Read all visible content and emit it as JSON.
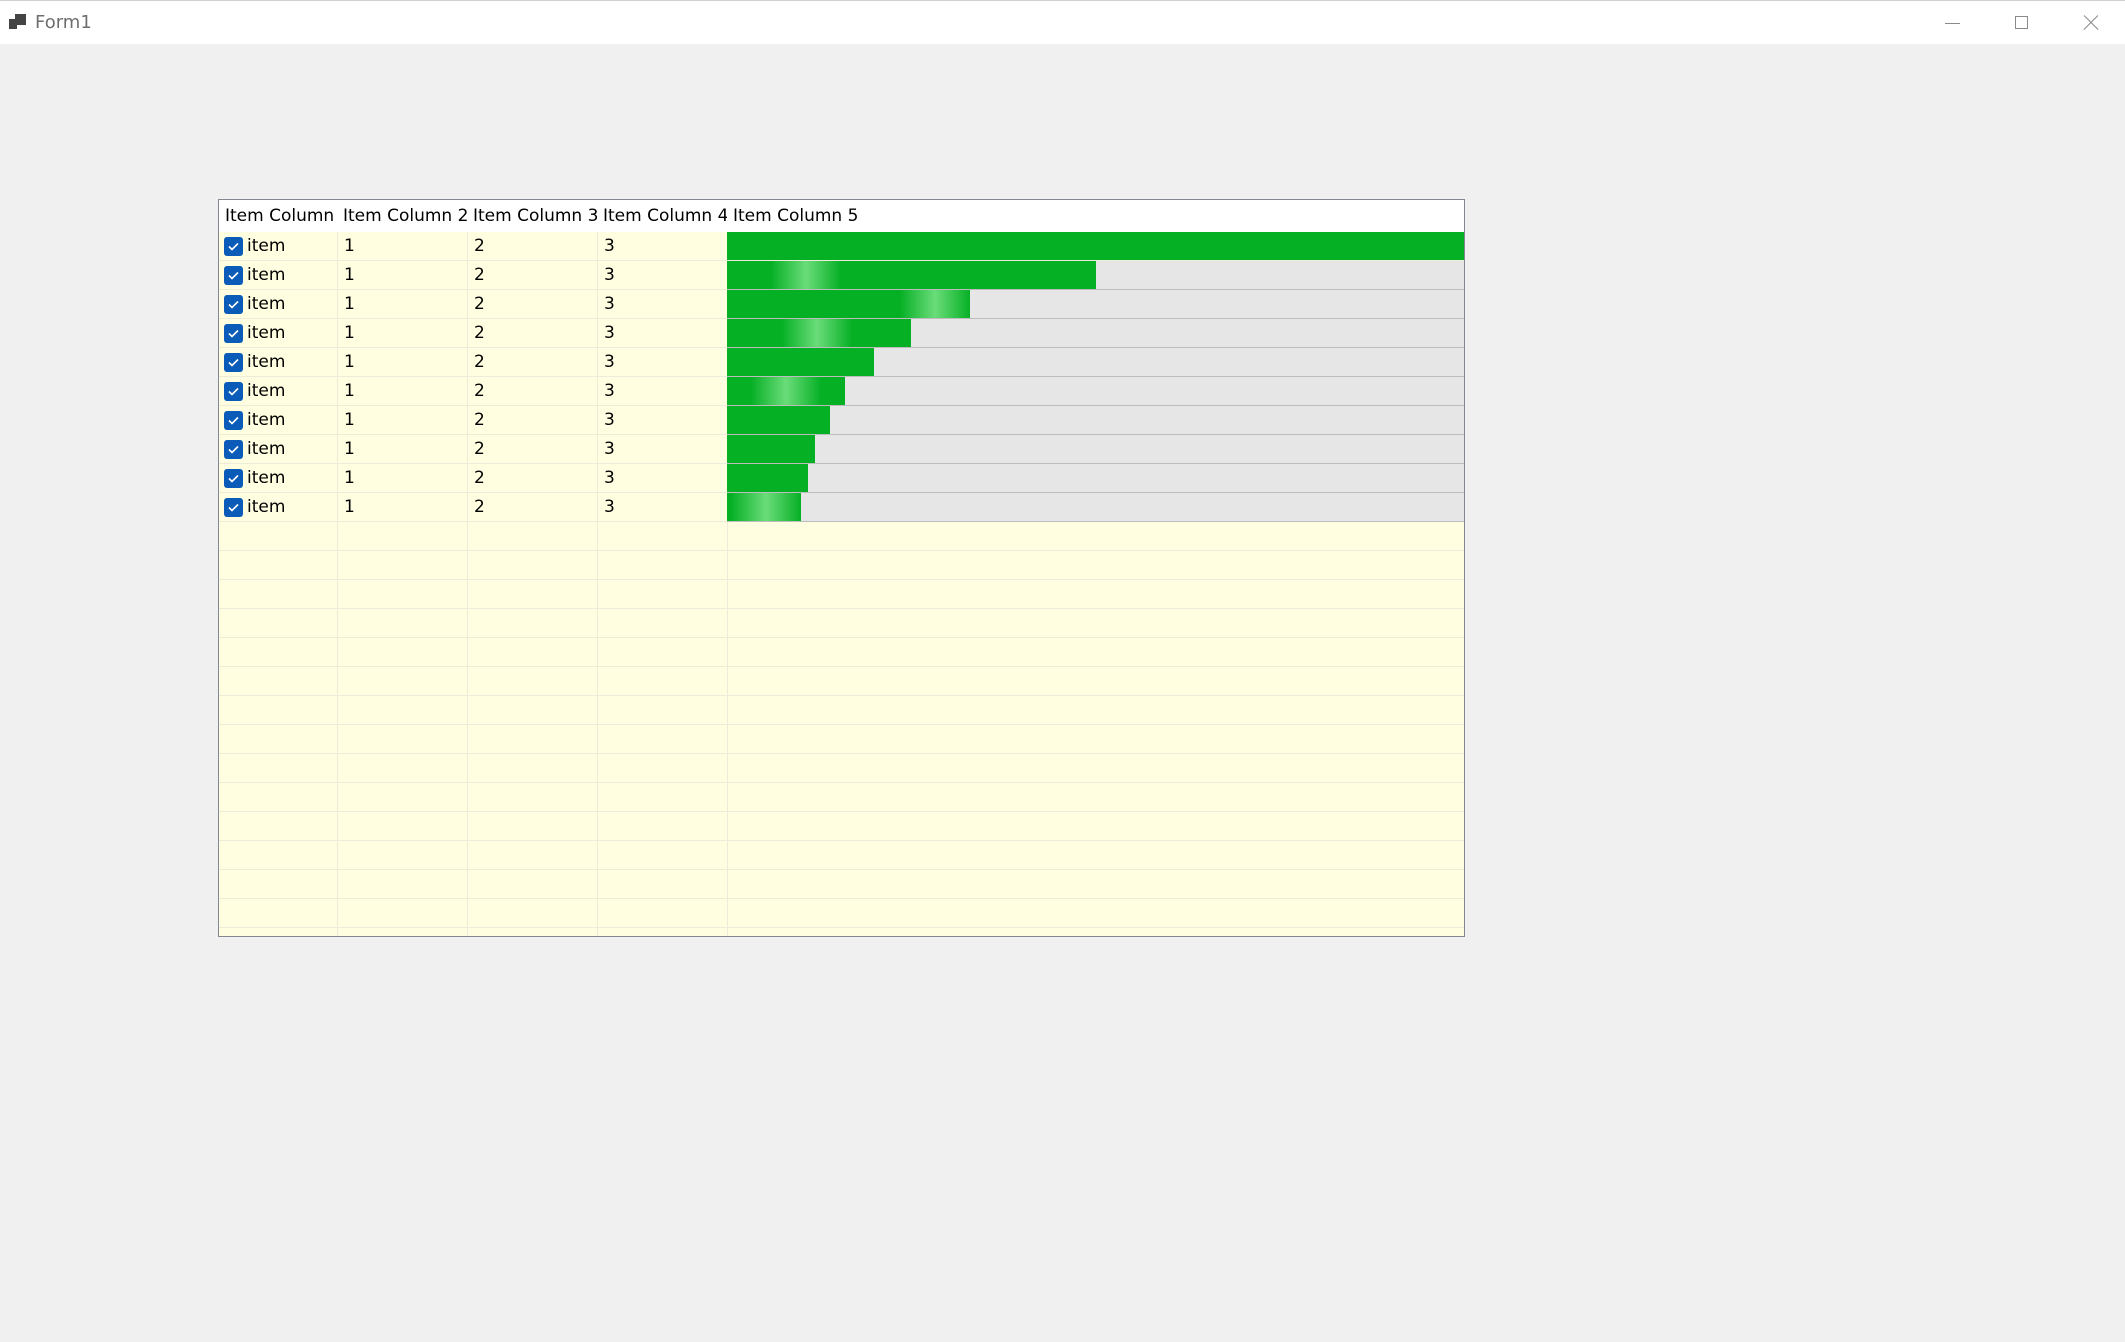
{
  "window": {
    "title": "Form1"
  },
  "listview": {
    "columns": [
      "Item Column",
      "Item Column 2",
      "Item Column 3",
      "Item Column 4",
      "Item Column 5"
    ],
    "rows": [
      {
        "checked": true,
        "c1": "item",
        "c2": "1",
        "c3": "2",
        "c4": "3",
        "progress": 1.0
      },
      {
        "checked": true,
        "c1": "item",
        "c2": "1",
        "c3": "2",
        "c4": "3",
        "progress": 0.5
      },
      {
        "checked": true,
        "c1": "item",
        "c2": "1",
        "c3": "2",
        "c4": "3",
        "progress": 0.33
      },
      {
        "checked": true,
        "c1": "item",
        "c2": "1",
        "c3": "2",
        "c4": "3",
        "progress": 0.25
      },
      {
        "checked": true,
        "c1": "item",
        "c2": "1",
        "c3": "2",
        "c4": "3",
        "progress": 0.2
      },
      {
        "checked": true,
        "c1": "item",
        "c2": "1",
        "c3": "2",
        "c4": "3",
        "progress": 0.16
      },
      {
        "checked": true,
        "c1": "item",
        "c2": "1",
        "c3": "2",
        "c4": "3",
        "progress": 0.14
      },
      {
        "checked": true,
        "c1": "item",
        "c2": "1",
        "c3": "2",
        "c4": "3",
        "progress": 0.12
      },
      {
        "checked": true,
        "c1": "item",
        "c2": "1",
        "c3": "2",
        "c4": "3",
        "progress": 0.11
      },
      {
        "checked": true,
        "c1": "item",
        "c2": "1",
        "c3": "2",
        "c4": "3",
        "progress": 0.1
      }
    ]
  },
  "colors": {
    "list_background": "#fffee0",
    "progress_fill": "#06b025",
    "progress_track": "#e6e6e6",
    "checkbox": "#0a5cb8"
  }
}
